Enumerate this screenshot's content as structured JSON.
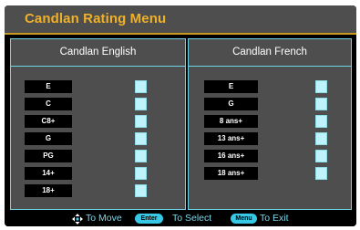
{
  "title": "Candlan Rating Menu",
  "english": {
    "heading": "Candlan English",
    "ratings": [
      "E",
      "C",
      "C8+",
      "G",
      "PG",
      "14+",
      "18+"
    ]
  },
  "french": {
    "heading": "Candlan French",
    "ratings": [
      "E",
      "G",
      "8 ans+",
      "13 ans+",
      "16 ans+",
      "18 ans+"
    ]
  },
  "footer": {
    "move_text": "To Move",
    "enter_key": "Enter",
    "select_text": "To Select",
    "menu_key": "Menu",
    "exit_text": "To Exit"
  },
  "colors": {
    "title": "#f0b028",
    "panel_bg": "#4e4e4e",
    "panel_border": "#6fd6e8",
    "checkbox": "#bff3fb",
    "key_pill": "#37c8e6",
    "footer_text": "#7cd8ea"
  },
  "icons": {
    "navigation": "four-way-arrows-icon"
  }
}
